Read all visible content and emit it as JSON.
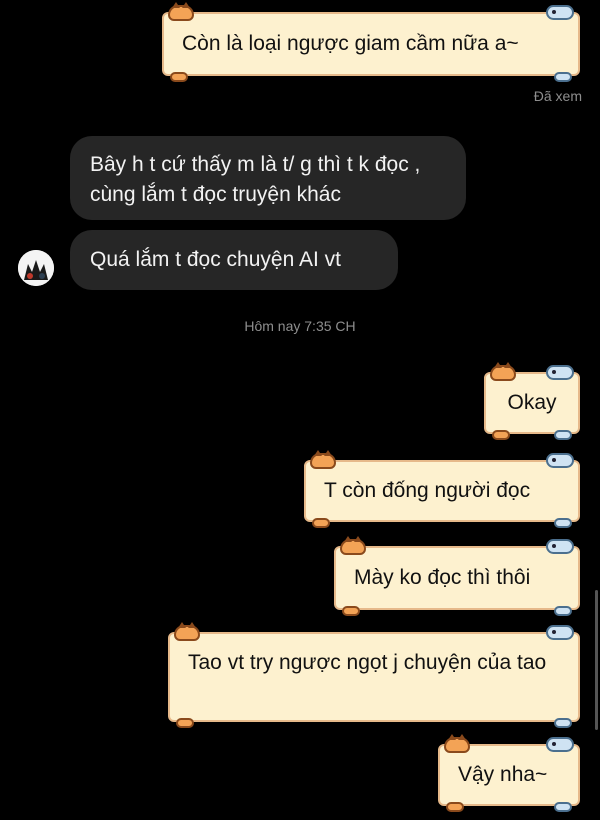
{
  "chat": {
    "seen_label": "Đã xem",
    "timestamp": "Hôm nay 7:35 CH",
    "messages": [
      {
        "text": "Còn là loại ngược giam cầm nữa a~",
        "direction": "outgoing"
      },
      {
        "text": "Bây h t cứ thấy m là t/ g thì t k đọc  , cùng lắm t đọc truyện khác",
        "direction": "incoming"
      },
      {
        "text": "Quá lắm t đọc chuyện AI vt",
        "direction": "incoming"
      },
      {
        "text": "Okay",
        "direction": "outgoing"
      },
      {
        "text": "T còn đống người đọc",
        "direction": "outgoing"
      },
      {
        "text": "Mày ko đọc thì thôi",
        "direction": "outgoing"
      },
      {
        "text": "Tao vt try ngược ngọt j chuyện của tao",
        "direction": "outgoing"
      },
      {
        "text": "Vậy nha~",
        "direction": "outgoing"
      }
    ]
  },
  "theme": {
    "outgoing_bubble_color": "#fdf1cf",
    "outgoing_border_color": "#e6b98a",
    "incoming_bubble_color": "#262626",
    "background": "#000000"
  },
  "icons": {
    "bubble_decoration_left": "cat-icon",
    "bubble_decoration_right": "dog-icon",
    "avatar": "avatar-icon"
  }
}
